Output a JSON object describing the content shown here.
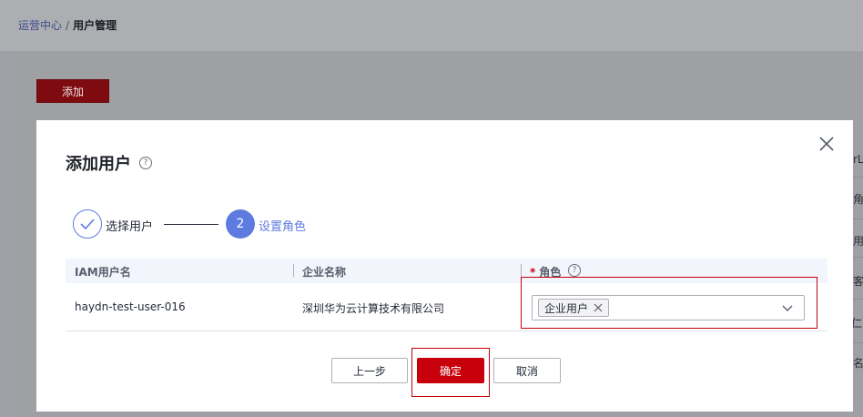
{
  "breadcrumb": {
    "parent": "运营中心",
    "separator": "/",
    "current": "用户管理"
  },
  "page": {
    "add_button": "添加"
  },
  "background_table_fragments": [
    "rL",
    "角色",
    "用户",
    "客",
    "仁",
    "名"
  ],
  "dialog": {
    "title": "添加用户",
    "help_glyph": "?",
    "close_glyph": "close",
    "steps": [
      {
        "index": "1",
        "label": "选择用户",
        "status": "done"
      },
      {
        "index": "2",
        "label": "设置角色",
        "status": "active"
      }
    ],
    "table": {
      "columns": [
        "IAM用户名",
        "企业名称",
        "角色"
      ],
      "role_required_mark": "*",
      "rows": [
        {
          "iam_user": "haydn-test-user-016",
          "company": "深圳华为云计算技术有限公司",
          "roles": [
            "企业用户"
          ]
        }
      ]
    },
    "buttons": {
      "prev": "上一步",
      "confirm": "确定",
      "cancel": "取消"
    }
  },
  "colors": {
    "primary_red": "#c7000b",
    "step_blue": "#5e7ce0",
    "overlay": "#a0a1a6"
  }
}
